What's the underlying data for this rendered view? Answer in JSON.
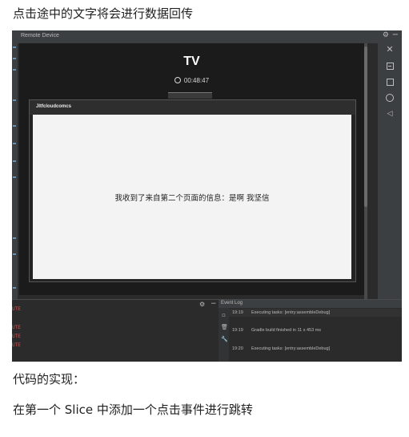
{
  "captions": {
    "top": "点击途中的文字将会进行数据回传",
    "middle": "代码的实现：",
    "bottom": "在第一个 Slice 中添加一个点击事件进行跳转"
  },
  "remote_device": {
    "title": "Remote Device",
    "icons": [
      "gear-icon",
      "minimize-icon"
    ]
  },
  "device": {
    "title": "TV",
    "timer": "00:48:47",
    "app_title": "Jltfcloudcomcs",
    "message": "我收到了来自第二个页面的信息：是啊 我坚信"
  },
  "side_controls": [
    "close-icon",
    "window-icon",
    "square-icon",
    "home-circle-icon",
    "back-triangle-icon"
  ],
  "bottom_left_lines": [
    "UTE",
    "UTE",
    "UTE",
    "UTE"
  ],
  "event_log": {
    "title": "Event Log",
    "entries": [
      {
        "time": "19:19",
        "text": "Executing tasks: [entry:assembleDebug]"
      },
      {
        "time": "19:19",
        "text": "Gradle build finished in 11 s 453 ms"
      },
      {
        "time": "19:20",
        "text": "Executing tasks: [entry:assembleDebug]"
      }
    ]
  },
  "colors": {
    "ide_bg": "#2b2b2b",
    "panel_bg": "#3c3f41",
    "device_bg": "#1b1b1b",
    "content_bg": "#f3f3f3",
    "error_text": "#d9534f"
  }
}
